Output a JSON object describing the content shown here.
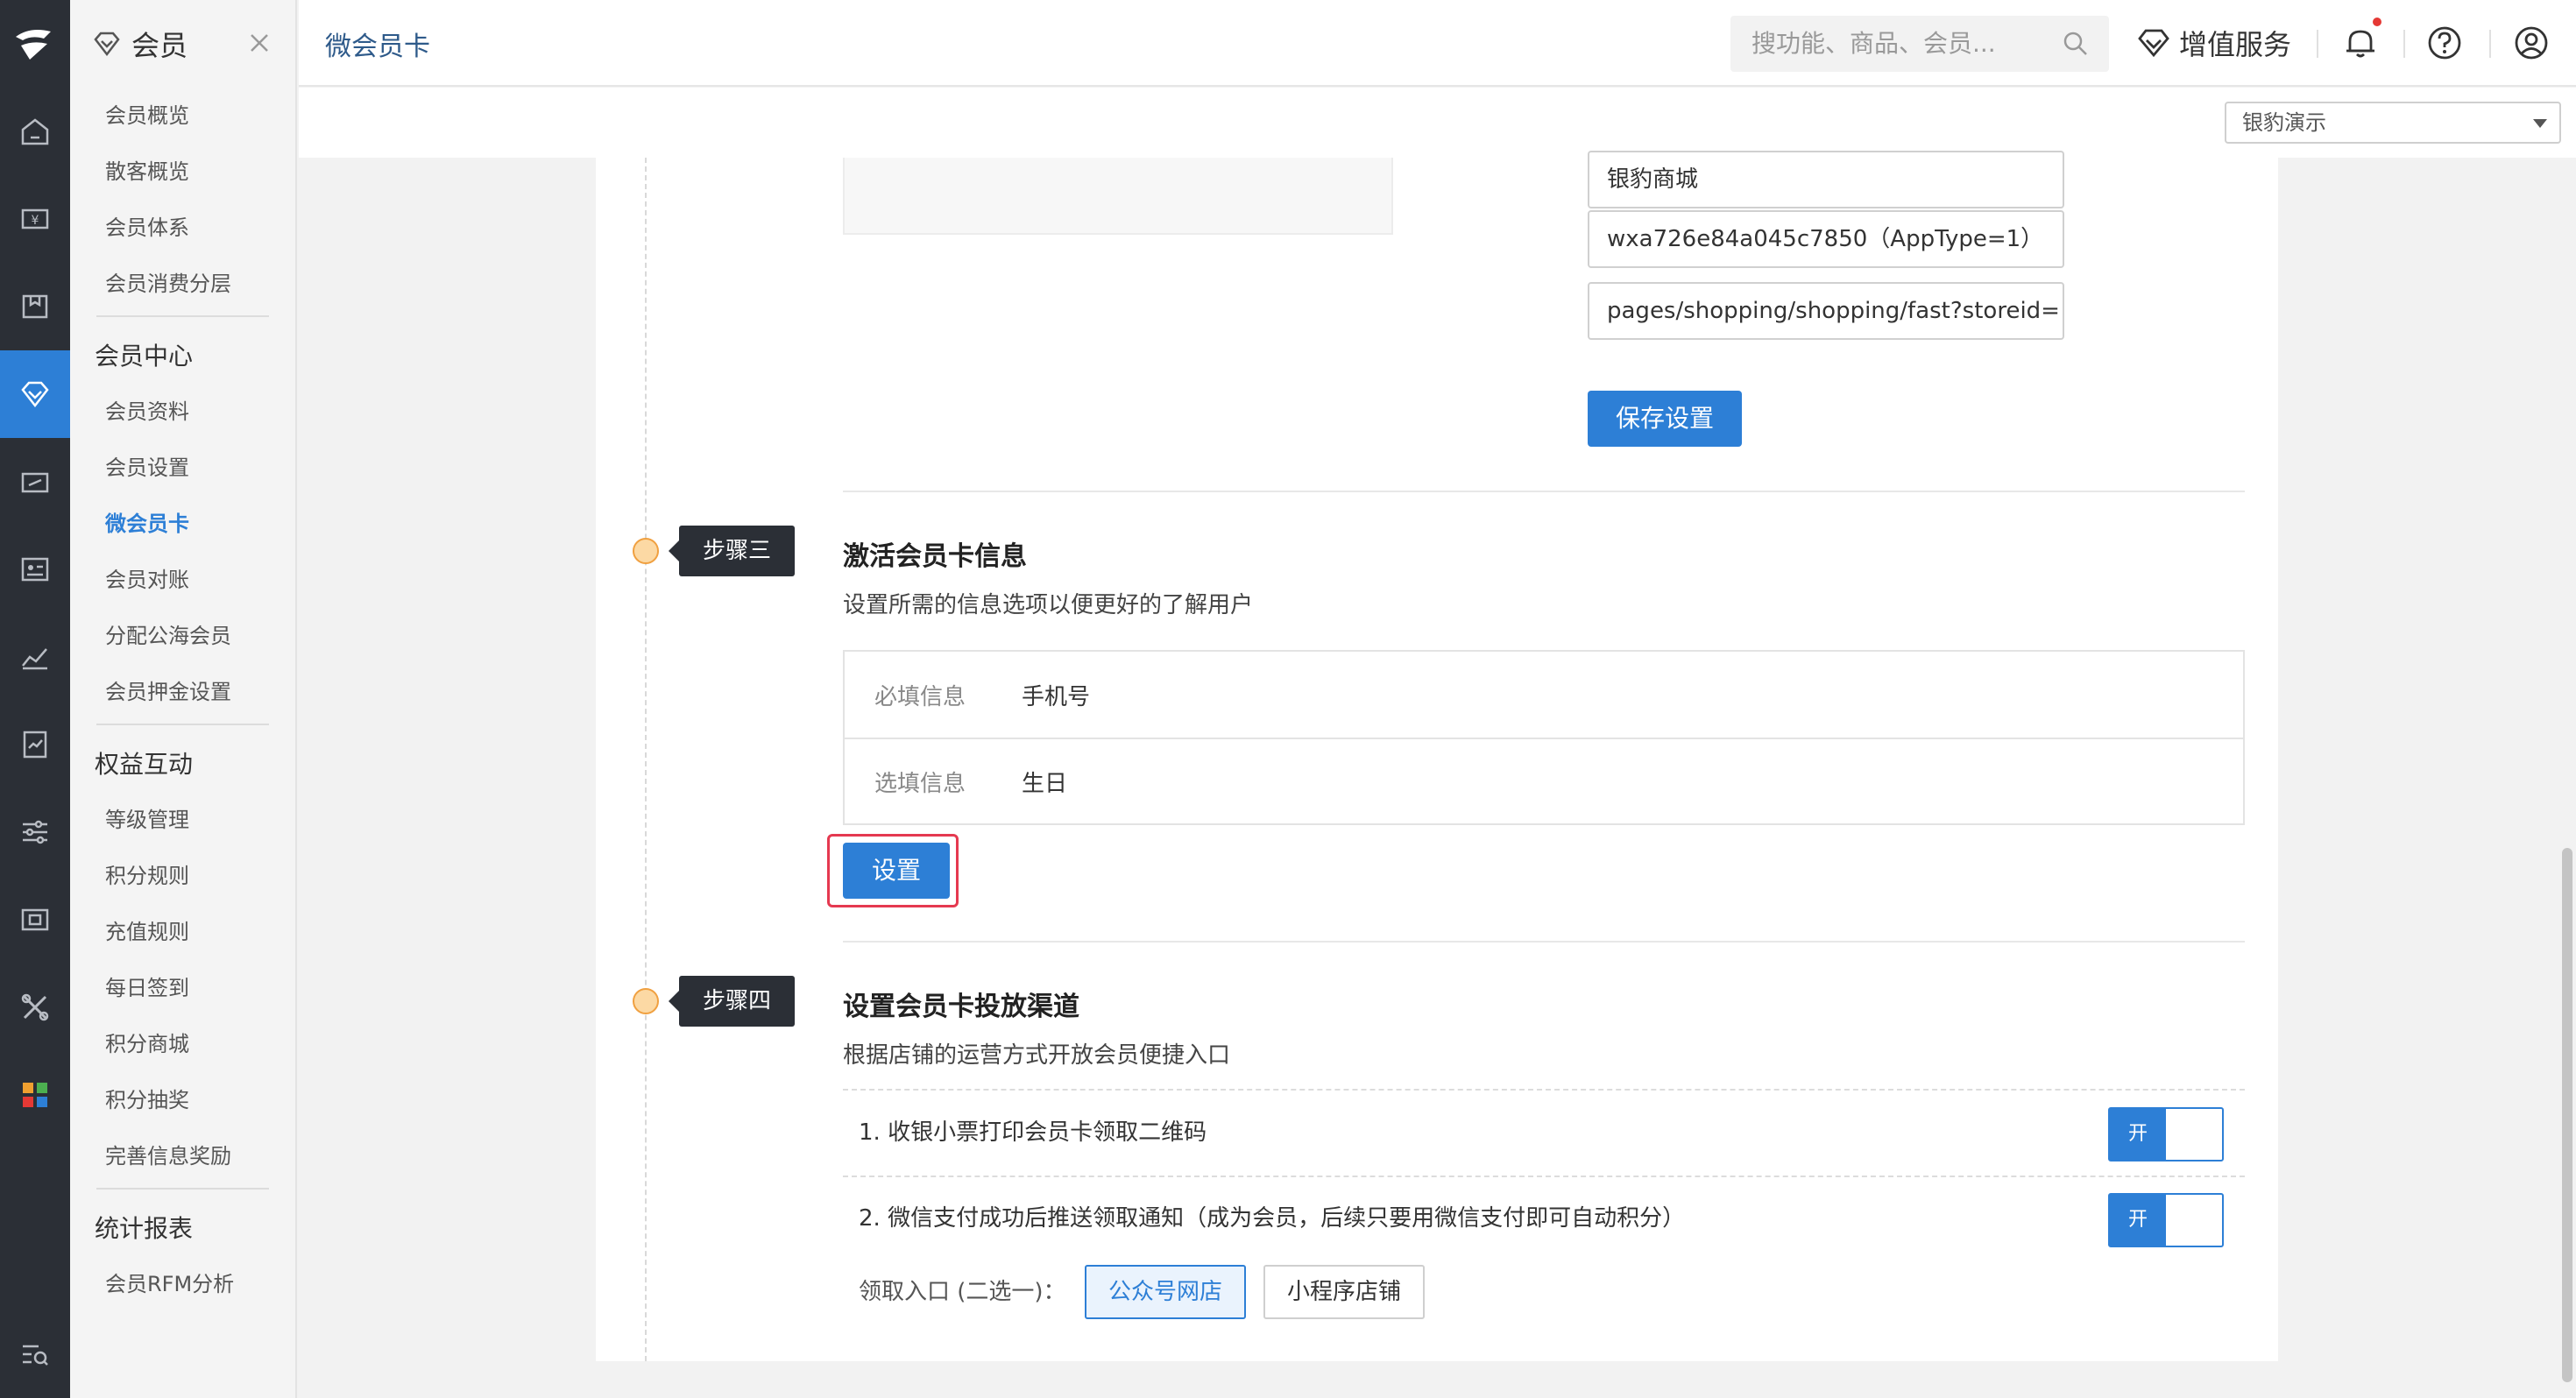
{
  "sidebar": {
    "title": "会员",
    "items_a": [
      "会员概览",
      "散客概览",
      "会员体系",
      "会员消费分层"
    ],
    "group_member_center": "会员中心",
    "items_b": [
      "会员资料",
      "会员设置",
      "微会员卡",
      "会员对账",
      "分配公海会员",
      "会员押金设置"
    ],
    "group_rights": "权益互动",
    "items_c": [
      "等级管理",
      "积分规则",
      "充值规则",
      "每日签到",
      "积分商城",
      "积分抽奖",
      "完善信息奖励"
    ],
    "group_stats": "统计报表",
    "items_d": [
      "会员RFM分析"
    ],
    "active_item": "微会员卡"
  },
  "header": {
    "breadcrumb": "微会员卡",
    "search_placeholder": "搜功能、商品、会员...",
    "value_added": "增值服务"
  },
  "store_select": {
    "value": "银豹演示"
  },
  "mini_program": {
    "name": "银豹商城",
    "appid": "wxa726e84a045c7850（AppType=1）",
    "path": "pages/shopping/shopping/fast?storeid={sto",
    "save_label": "保存设置"
  },
  "step3": {
    "tag": "步骤三",
    "title": "激活会员卡信息",
    "desc": "设置所需的信息选项以便更好的了解用户",
    "required_label": "必填信息",
    "required_value": "手机号",
    "optional_label": "选填信息",
    "optional_value": "生日",
    "set_label": "设置"
  },
  "step4": {
    "tag": "步骤四",
    "title": "设置会员卡投放渠道",
    "desc": "根据店铺的运营方式开放会员便捷入口",
    "channel1": "1. 收银小票打印会员卡领取二维码",
    "channel2": "2. 微信支付成功后推送领取通知（成为会员，后续只要用微信支付即可自动积分）",
    "toggle_on": "开",
    "entry_label": "领取入口 (二选一)：",
    "entry_option1": "公众号网店",
    "entry_option2": "小程序店铺",
    "entry_selected": "公众号网店"
  },
  "colors": {
    "accent": "#2d7fd6",
    "rail": "#2b2f36",
    "highlight": "#e53950",
    "step_dot": "#f0a040"
  }
}
